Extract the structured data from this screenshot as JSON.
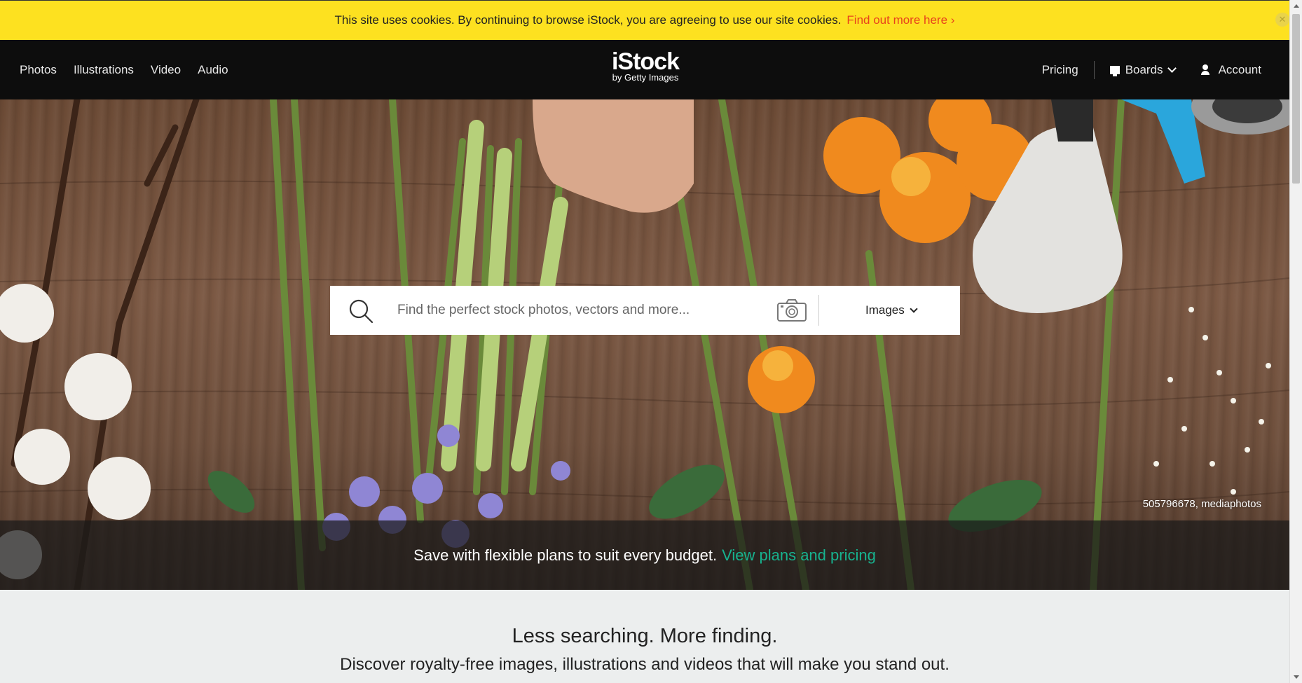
{
  "cookie_bar": {
    "message": "This site uses cookies. By continuing to browse iStock, you are agreeing to use our site cookies.",
    "link": "Find out more here ›",
    "close_icon": "close-circle-icon"
  },
  "header": {
    "nav_left": [
      "Photos",
      "Illustrations",
      "Video",
      "Audio"
    ],
    "logo": {
      "brand": "iStock",
      "sub": "by Getty Images"
    },
    "pricing": "Pricing",
    "boards": "Boards",
    "account": "Account"
  },
  "search": {
    "placeholder": "Find the perfect stock photos, vectors and more...",
    "type": "Images",
    "search_icon": "search-icon",
    "camera_icon": "camera-icon"
  },
  "hero": {
    "credit": "505796678, mediaphotos",
    "promo_text": "Save with flexible plans to suit every budget.",
    "promo_link": "View plans and pricing"
  },
  "intro": {
    "title": "Less searching. More finding.",
    "subtitle": "Discover royalty-free images, illustrations and videos that will make you stand out."
  },
  "colors": {
    "cookie_bar": "#fde120",
    "cookie_link": "#e8421c",
    "header_bg": "#0d0d0d",
    "promo_link": "#17b38f"
  }
}
